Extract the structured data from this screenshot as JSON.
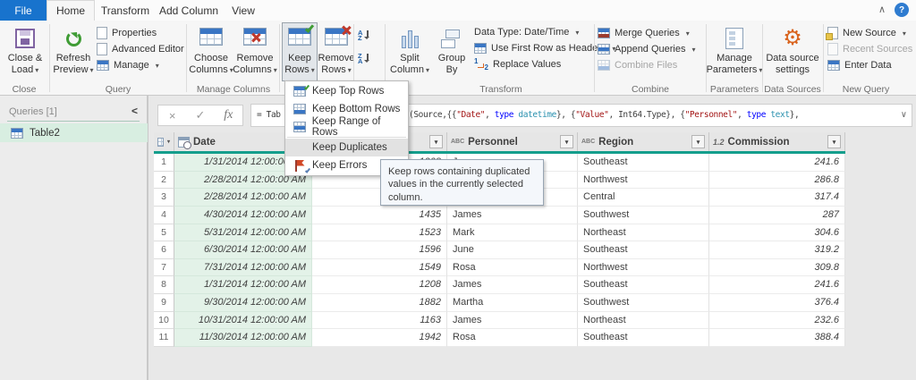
{
  "colors": {
    "file_blue": "#1873cd",
    "accent_teal": "#149e8c",
    "selected_green": "#e3f2e8",
    "string_red": "#a31515",
    "keyword_blue": "#0000ff",
    "type_teal": "#2b91af"
  },
  "icons": {
    "caret": "▾",
    "collapse": "∧",
    "help": "?",
    "pane_collapse": "<",
    "expand": "∨",
    "cancel": "×",
    "check": "✓",
    "fx": "fx",
    "gear": "⚙",
    "letter_a": "A",
    "letter_z": "Z",
    "one": "1",
    "two": "2"
  },
  "tabs": {
    "file": "File",
    "home": "Home",
    "transform": "Transform",
    "add_column": "Add Column",
    "view": "View"
  },
  "ribbon": {
    "close_load_1": "Close &",
    "close_load_2": "Load",
    "refresh_1": "Refresh",
    "refresh_2": "Preview",
    "properties": "Properties",
    "advanced_editor": "Advanced Editor",
    "manage": "Manage",
    "choose_columns_1": "Choose",
    "choose_columns_2": "Columns",
    "remove_columns_1": "Remove",
    "remove_columns_2": "Columns",
    "keep_rows_1": "Keep",
    "keep_rows_2": "Rows",
    "remove_rows_1": "Remove",
    "remove_rows_2": "Rows",
    "split_column_1": "Split",
    "split_column_2": "Column",
    "group_by_1": "Group",
    "group_by_2": "By",
    "data_type": "Data Type: Date/Time",
    "first_row_headers": "Use First Row as Headers",
    "replace_values": "Replace Values",
    "merge_queries": "Merge Queries",
    "append_queries": "Append Queries",
    "combine_files": "Combine Files",
    "manage_parameters_1": "Manage",
    "manage_parameters_2": "Parameters",
    "data_source_1": "Data source",
    "data_source_2": "settings",
    "new_source": "New Source",
    "recent_sources": "Recent Sources",
    "enter_data": "Enter Data",
    "labels": {
      "close": "Close",
      "query": "Query",
      "manage_columns": "Manage Columns",
      "transform": "Transform",
      "combine": "Combine",
      "parameters": "Parameters",
      "data_sources": "Data Sources",
      "new_query": "New Query"
    }
  },
  "formula": {
    "prefix": "= Tab",
    "p0": "(Source,{{",
    "s1": "\"Date\"",
    "p1": ", ",
    "k1": "type ",
    "t1": "datetime",
    "p2": "}, {",
    "s2": "\"Value\"",
    "p3": ", Int64.Type}, {",
    "s3": "\"Personnel\"",
    "p4": ", ",
    "k2": "type ",
    "t2": "text",
    "p5": "},"
  },
  "queries_pane": {
    "title": "Queries [1]",
    "item": "Table2"
  },
  "menu": {
    "items": [
      "Keep Top Rows",
      "Keep Bottom Rows",
      "Keep Range of Rows",
      "Keep Duplicates",
      "Keep Errors"
    ],
    "hovered": "Keep Duplicates"
  },
  "tooltip": {
    "text": "Keep rows containing duplicated values in the currently selected column."
  },
  "grid": {
    "headers": {
      "date": {
        "label": "Date"
      },
      "value": {
        "label": ""
      },
      "personnel": {
        "label": "Personnel",
        "type": "ABC"
      },
      "region": {
        "label": "Region",
        "type": "ABC"
      },
      "commission": {
        "label": "Commission",
        "type": "1.2"
      }
    },
    "rows": [
      {
        "num": "1",
        "date": "1/31/2014 12:00:00 AM",
        "value": "1208",
        "personnel": "James",
        "region": "Southeast",
        "commission": "241.6"
      },
      {
        "num": "2",
        "date": "2/28/2014 12:00:00 AM",
        "value": "",
        "personnel": "",
        "region": "Northwest",
        "commission": "286.8"
      },
      {
        "num": "3",
        "date": "2/28/2014 12:00:00 AM",
        "value": "",
        "personnel": "",
        "region": "Central",
        "commission": "317.4"
      },
      {
        "num": "4",
        "date": "4/30/2014 12:00:00 AM",
        "value": "1435",
        "personnel": "James",
        "region": "Southwest",
        "commission": "287"
      },
      {
        "num": "5",
        "date": "5/31/2014 12:00:00 AM",
        "value": "1523",
        "personnel": "Mark",
        "region": "Northeast",
        "commission": "304.6"
      },
      {
        "num": "6",
        "date": "6/30/2014 12:00:00 AM",
        "value": "1596",
        "personnel": "June",
        "region": "Southeast",
        "commission": "319.2"
      },
      {
        "num": "7",
        "date": "7/31/2014 12:00:00 AM",
        "value": "1549",
        "personnel": "Rosa",
        "region": "Northwest",
        "commission": "309.8"
      },
      {
        "num": "8",
        "date": "1/31/2014 12:00:00 AM",
        "value": "1208",
        "personnel": "James",
        "region": "Southeast",
        "commission": "241.6"
      },
      {
        "num": "9",
        "date": "9/30/2014 12:00:00 AM",
        "value": "1882",
        "personnel": "Martha",
        "region": "Southwest",
        "commission": "376.4"
      },
      {
        "num": "10",
        "date": "10/31/2014 12:00:00 AM",
        "value": "1163",
        "personnel": "James",
        "region": "Northeast",
        "commission": "232.6"
      },
      {
        "num": "11",
        "date": "11/30/2014 12:00:00 AM",
        "value": "1942",
        "personnel": "Rosa",
        "region": "Southeast",
        "commission": "388.4"
      }
    ]
  }
}
